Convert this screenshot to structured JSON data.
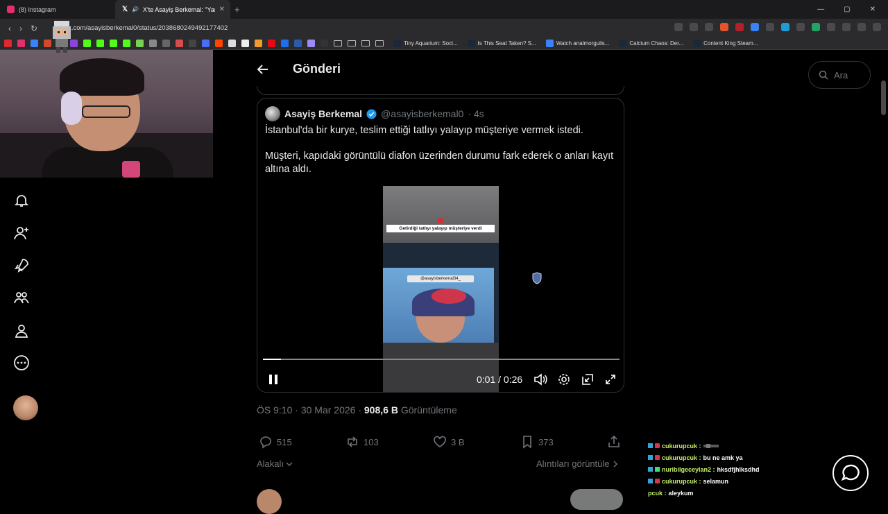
{
  "browser": {
    "tabs": [
      {
        "title": "(8) Instagram",
        "active": false,
        "icon": "instagram-icon"
      },
      {
        "title": "X'te Asayiş Berkemal: \"Yanlış ...",
        "active": true,
        "icon": "x-logo-icon"
      }
    ],
    "url": "x.com/asayisberkemal0/status/2038680249492177402",
    "bookmarks": [
      {
        "label": "Tiny Aquarium: Soci..."
      },
      {
        "label": "Is This Seat Taken? S..."
      },
      {
        "label": "Watch analmorgulis..."
      },
      {
        "label": "Calcium Chaos: Der..."
      },
      {
        "label": "Content King Steam..."
      }
    ]
  },
  "page": {
    "header_title": "Gönderi",
    "search_placeholder": "Ara"
  },
  "quote": {
    "author_name": "Asayiş Berkemal",
    "author_handle": "@asayisberkemal0",
    "time_ago": "· 4s",
    "text_p1": "İstanbul'da bir kurye, teslim ettiği tatlıyı yalayıp müşteriye vermek istedi.",
    "text_p2": "Müşteri, kapıdaki görüntülü diafon üzerinden durumu fark ederek o anları kayıt altına aldı.",
    "video": {
      "caption": "Getirdiği tatlıyı yalayıp müşteriye verdi",
      "watermark": "@asayisberkemal34_",
      "time_current": "0:01",
      "time_total": "0:26",
      "progress_fraction": 0.05
    }
  },
  "post_meta": {
    "time": "ÖS 9:10",
    "date": "30 Mar 2026",
    "views": "908,6 B",
    "views_label": "Görüntüleme"
  },
  "actions": {
    "replies": "515",
    "reposts": "103",
    "likes": "3 B",
    "bookmarks": "373"
  },
  "filters": {
    "relevance": "Alakalı",
    "quotes_link": "Alıntıları görüntüle"
  },
  "chat": [
    {
      "user": "cukurupcuk :",
      "msg": ""
    },
    {
      "user": "cukurupcuk :",
      "msg": "bu ne amk ya"
    },
    {
      "user": "nuribilgeceylan2 :",
      "msg": "hksdfjhlksdhd"
    },
    {
      "user": "cukurupcuk :",
      "msg": "selamun"
    },
    {
      "user": "pcuk :",
      "msg": "aleykum"
    }
  ],
  "colors": {
    "accent": "#1d9bf0",
    "chat_user": "#c8f26b",
    "border": "#2f3336",
    "muted": "#71767b"
  }
}
